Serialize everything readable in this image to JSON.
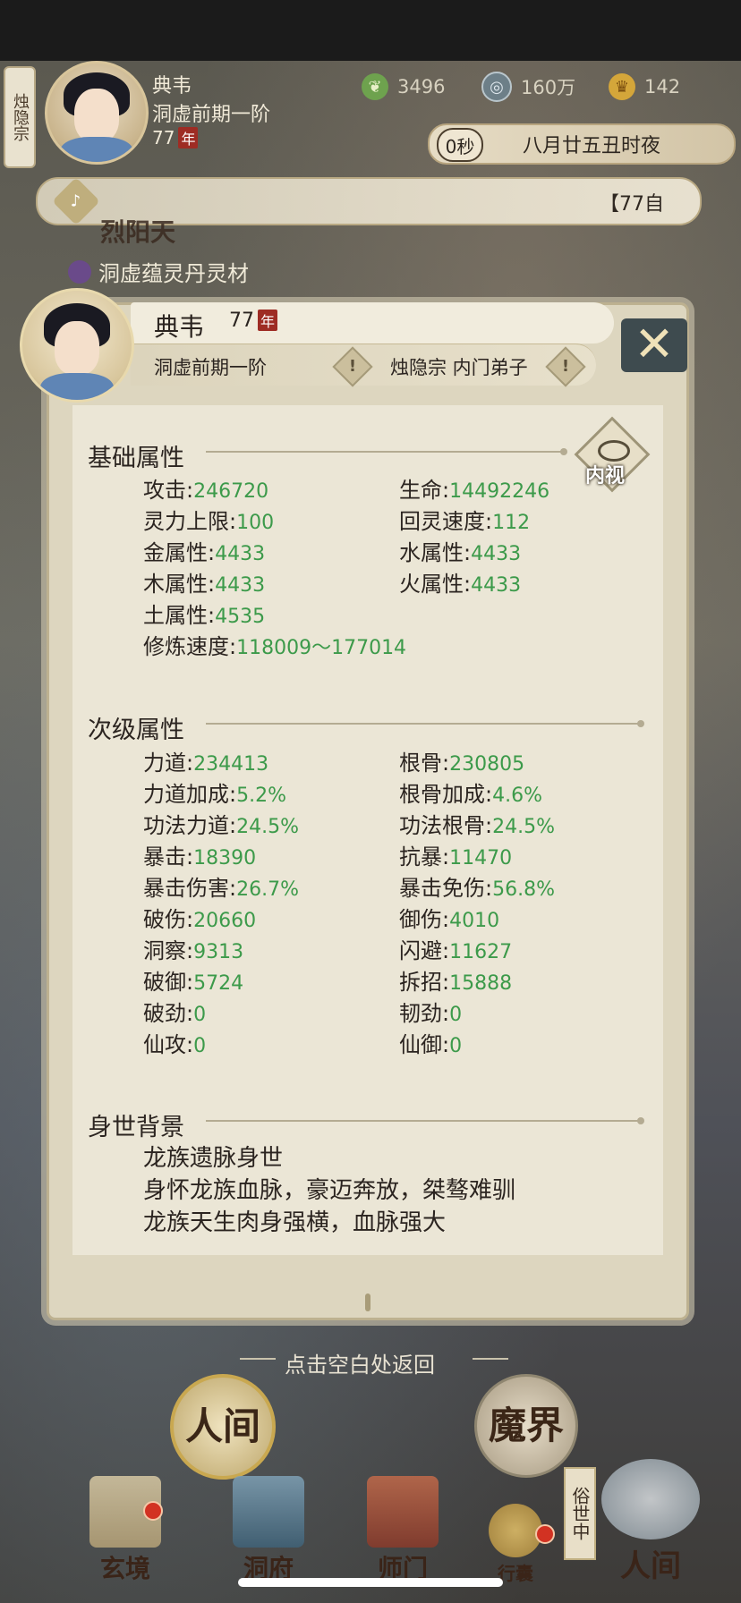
{
  "header": {
    "sect_tab": "烛隐宗",
    "name": "典韦",
    "realm": "洞虚前期一阶",
    "age": "77",
    "age_badge": "年",
    "resources": [
      {
        "icon": "jade-leaf-icon",
        "value": "3496"
      },
      {
        "icon": "coin-icon",
        "value": "160万"
      },
      {
        "icon": "gold-ingot-icon",
        "value": "142"
      }
    ],
    "time_seconds": "0秒",
    "time_text": "八月廿五丑时夜",
    "marquee": "【77自"
  },
  "event": {
    "title": "烈阳天",
    "item": "洞虚蕴灵丹灵材"
  },
  "profile": {
    "name": "典韦",
    "age": "77",
    "age_badge": "年",
    "realm": "洞虚前期一阶",
    "sect": "烛隐宗 内门弟子",
    "warn_icon": "!"
  },
  "sections": {
    "basic_title": "基础属性",
    "secondary_title": "次级属性",
    "background_title": "身世背景",
    "inner_view": "内视"
  },
  "basic_attrs": [
    {
      "label": "攻击",
      "value": "246720"
    },
    {
      "label": "生命",
      "value": "14492246"
    },
    {
      "label": "灵力上限",
      "value": "100"
    },
    {
      "label": "回灵速度",
      "value": "112"
    },
    {
      "label": "金属性",
      "value": "4433"
    },
    {
      "label": "水属性",
      "value": "4433"
    },
    {
      "label": "木属性",
      "value": "4433"
    },
    {
      "label": "火属性",
      "value": "4433"
    },
    {
      "label": "土属性",
      "value": "4535"
    },
    {
      "label": "修炼速度",
      "value": "118009～177014"
    }
  ],
  "secondary_attrs": [
    {
      "label": "力道",
      "value": "234413"
    },
    {
      "label": "根骨",
      "value": "230805"
    },
    {
      "label": "力道加成",
      "value": "5.2%"
    },
    {
      "label": "根骨加成",
      "value": "4.6%"
    },
    {
      "label": "功法力道",
      "value": "24.5%"
    },
    {
      "label": "功法根骨",
      "value": "24.5%"
    },
    {
      "label": "暴击",
      "value": "18390"
    },
    {
      "label": "抗暴",
      "value": "11470"
    },
    {
      "label": "暴击伤害",
      "value": "26.7%"
    },
    {
      "label": "暴击免伤",
      "value": "56.8%"
    },
    {
      "label": "破伤",
      "value": "20660"
    },
    {
      "label": "御伤",
      "value": "4010"
    },
    {
      "label": "洞察",
      "value": "9313"
    },
    {
      "label": "闪避",
      "value": "11627"
    },
    {
      "label": "破御",
      "value": "5724"
    },
    {
      "label": "拆招",
      "value": "15888"
    },
    {
      "label": "破劲",
      "value": "0"
    },
    {
      "label": "韧劲",
      "value": "0"
    },
    {
      "label": "仙攻",
      "value": "0"
    },
    {
      "label": "仙御",
      "value": "0"
    }
  ],
  "background": [
    "龙族遗脉身世",
    "身怀龙族血脉，豪迈奔放，桀骜难驯",
    "龙族天生肉身强横，血脉强大"
  ],
  "back_hint": "点击空白处返回",
  "nav": {
    "items": [
      "玄境",
      "洞府",
      "师门",
      "行囊",
      "人间"
    ],
    "human_world": "人间",
    "demon_world": "魔界",
    "side_tag": "俗世中"
  },
  "colors": {
    "value_green": "#3c9a4a",
    "badge_red": "#9e2c24",
    "panel_bg": "#ebe6d6"
  }
}
